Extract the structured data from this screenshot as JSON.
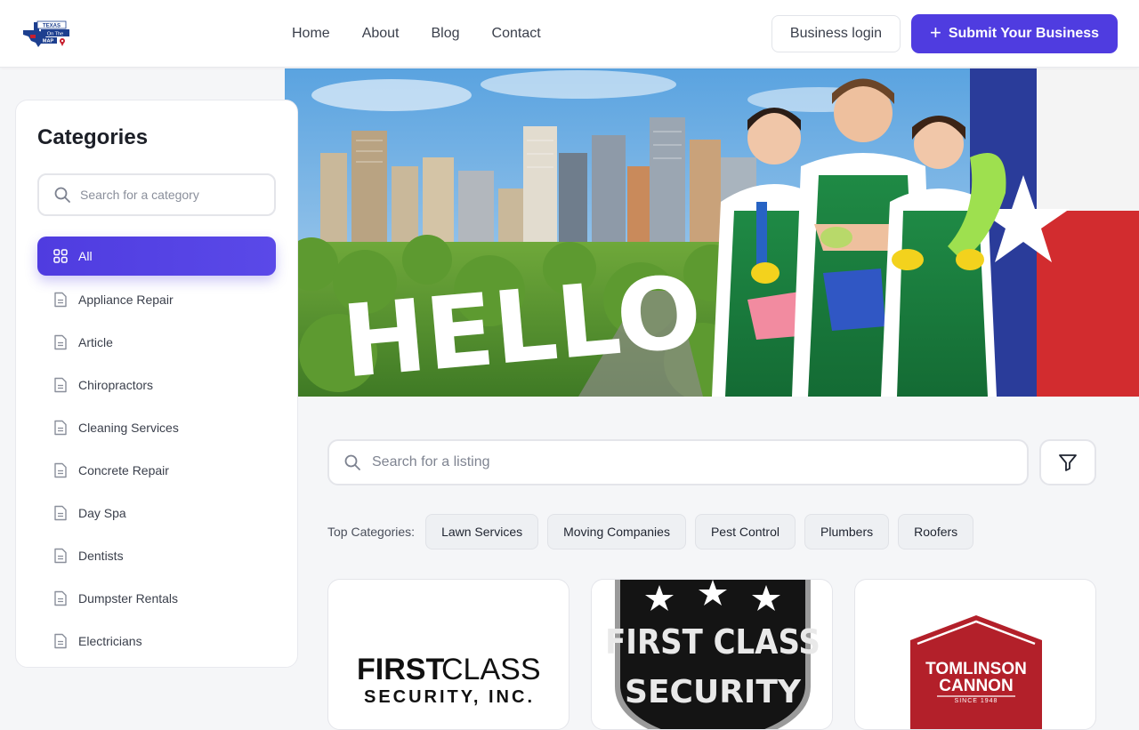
{
  "header": {
    "logo": {
      "line1": "TEXAS",
      "line2": "On The",
      "line3": "MAP"
    },
    "nav": [
      "Home",
      "About",
      "Blog",
      "Contact"
    ],
    "login_label": "Business login",
    "submit_label": "Submit Your Business"
  },
  "sidebar": {
    "title": "Categories",
    "search_placeholder": "Search for a category",
    "all_label": "All",
    "items": [
      "Appliance Repair",
      "Article",
      "Chiropractors",
      "Cleaning Services",
      "Concrete Repair",
      "Day Spa",
      "Dentists",
      "Dumpster Rentals",
      "Electricians"
    ]
  },
  "hero": {
    "text": "HELLO"
  },
  "listing": {
    "search_placeholder": "Search for a listing",
    "top_categories_label": "Top Categories:",
    "top_categories": [
      "Lawn Services",
      "Moving Companies",
      "Pest Control",
      "Plumbers",
      "Roofers"
    ]
  },
  "cards": [
    {
      "logo_line1a": "FIRST",
      "logo_line1b": "CLASS",
      "logo_line2": "SECURITY, INC."
    },
    {
      "logo_line1": "FIRST CLASS",
      "logo_line2": "SECURITY"
    },
    {
      "logo_line1": "TOMLINSON",
      "logo_line2": "CANNON",
      "logo_line3": "SINCE 1948"
    }
  ],
  "colors": {
    "accent": "#4f3ce0",
    "texas_red": "#c8202f",
    "texas_blue": "#1d3f8f"
  }
}
